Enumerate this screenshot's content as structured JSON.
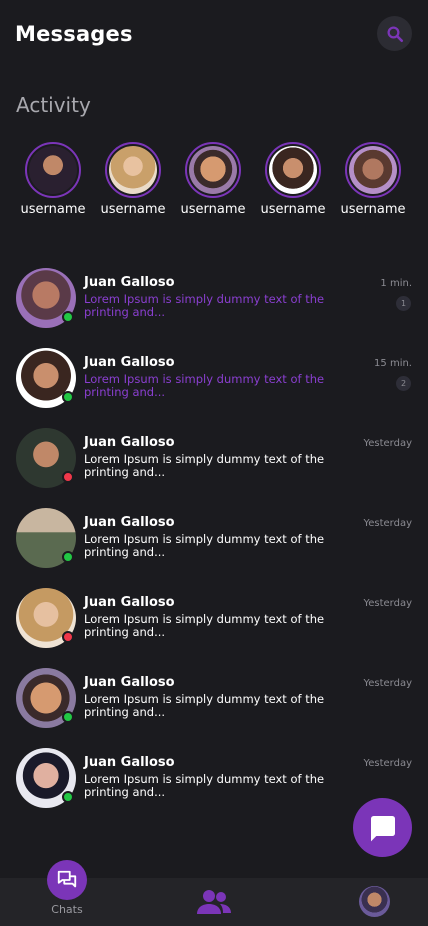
{
  "header": {
    "title": "Messages"
  },
  "activity": {
    "title": "Activity",
    "items": [
      {
        "username": "username"
      },
      {
        "username": "username"
      },
      {
        "username": "username"
      },
      {
        "username": "username"
      },
      {
        "username": "username"
      }
    ]
  },
  "conversations": [
    {
      "name": "Juan Galloso",
      "preview": "Lorem Ipsum is simply dummy text of the printing and...",
      "time": "1 min.",
      "unread": "1",
      "status": "online"
    },
    {
      "name": "Juan Galloso",
      "preview": "Lorem Ipsum is simply dummy text of the printing and...",
      "time": "15 min.",
      "unread": "2",
      "status": "online"
    },
    {
      "name": "Juan Galloso",
      "preview": "Lorem Ipsum is simply dummy text of the printing and...",
      "time": "Yesterday",
      "status": "offline"
    },
    {
      "name": "Juan Galloso",
      "preview": "Lorem Ipsum is simply dummy text of the printing and...",
      "time": "Yesterday",
      "status": "online"
    },
    {
      "name": "Juan Galloso",
      "preview": "Lorem Ipsum is simply dummy text of the printing and...",
      "time": "Yesterday",
      "status": "offline"
    },
    {
      "name": "Juan Galloso",
      "preview": "Lorem Ipsum is simply dummy text of the printing and...",
      "time": "Yesterday",
      "status": "online"
    },
    {
      "name": "Juan Galloso",
      "preview": "Lorem Ipsum is simply dummy text of the printing and...",
      "time": "Yesterday",
      "status": "online"
    }
  ],
  "nav": {
    "chats_label": "Chats"
  },
  "colors": {
    "accent": "#7b35b8",
    "unread_text": "#8a3fd0",
    "read_text": "#ffffff",
    "online": "#22c744",
    "offline": "#f0384a",
    "background": "#1b1b1f"
  }
}
